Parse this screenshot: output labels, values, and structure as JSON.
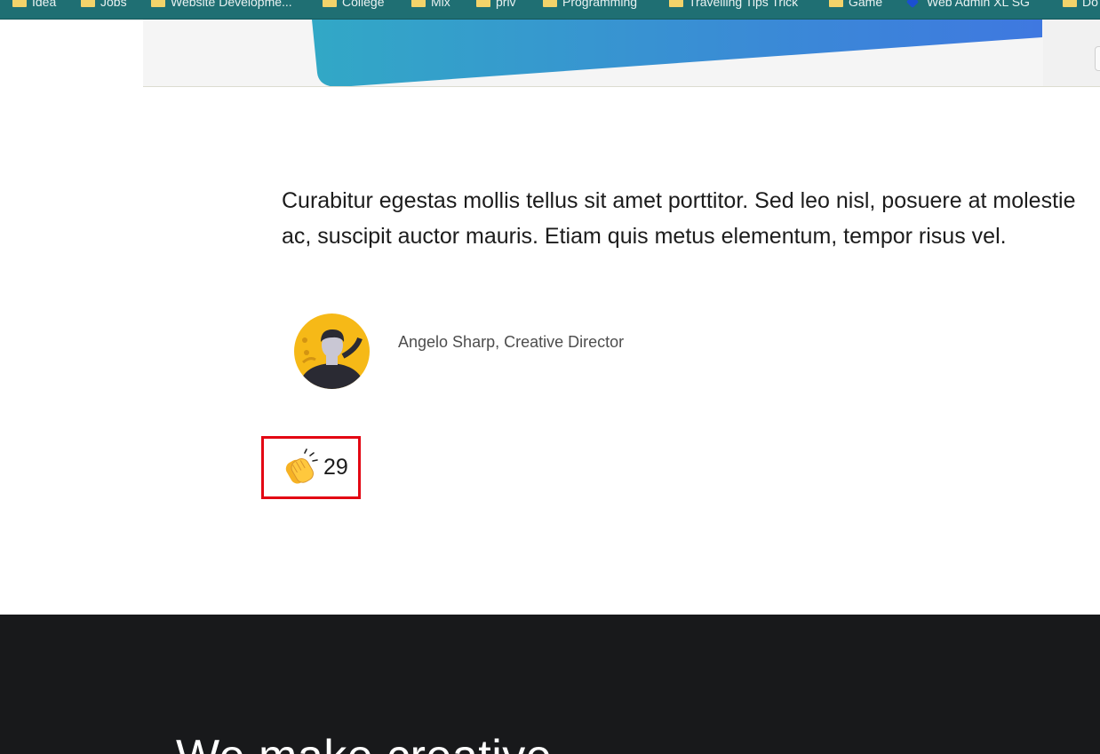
{
  "bookmarks": [
    {
      "label": "Idea",
      "icon": "folder-icon"
    },
    {
      "label": "Jobs",
      "icon": "folder-icon"
    },
    {
      "label": "Website Developme...",
      "icon": "folder-icon"
    },
    {
      "label": "College",
      "icon": "folder-icon"
    },
    {
      "label": "Mix",
      "icon": "folder-icon"
    },
    {
      "label": "priv",
      "icon": "folder-icon"
    },
    {
      "label": "Programming",
      "icon": "folder-icon"
    },
    {
      "label": "Travelling Tips Trick",
      "icon": "folder-icon"
    },
    {
      "label": "Game",
      "icon": "folder-icon"
    },
    {
      "label": "Web Admin XL SG",
      "icon": "web-admin-icon"
    },
    {
      "label": "Do",
      "icon": "folder-icon"
    }
  ],
  "testimonial": {
    "quote": "Curabitur egestas mollis tellus sit amet porttitor. Sed leo nisl, posuere at molestie ac, suscipit auctor mauris. Etiam quis metus elementum, tempor risus vel.",
    "author": "Angelo Sharp, Creative Director",
    "avatar_icon": "person-avatar-icon"
  },
  "clap": {
    "icon": "clapping-hands-icon",
    "count": "29",
    "highlight_color": "#e30613"
  },
  "footer": {
    "heading": "We make creative"
  },
  "colors": {
    "bookmarks_bar": "#1f6f73",
    "footer_bg": "#18191b",
    "avatar_bg": "#f6b917",
    "hero_gradient_start": "#32a8c6",
    "hero_gradient_end": "#3f78e0"
  }
}
